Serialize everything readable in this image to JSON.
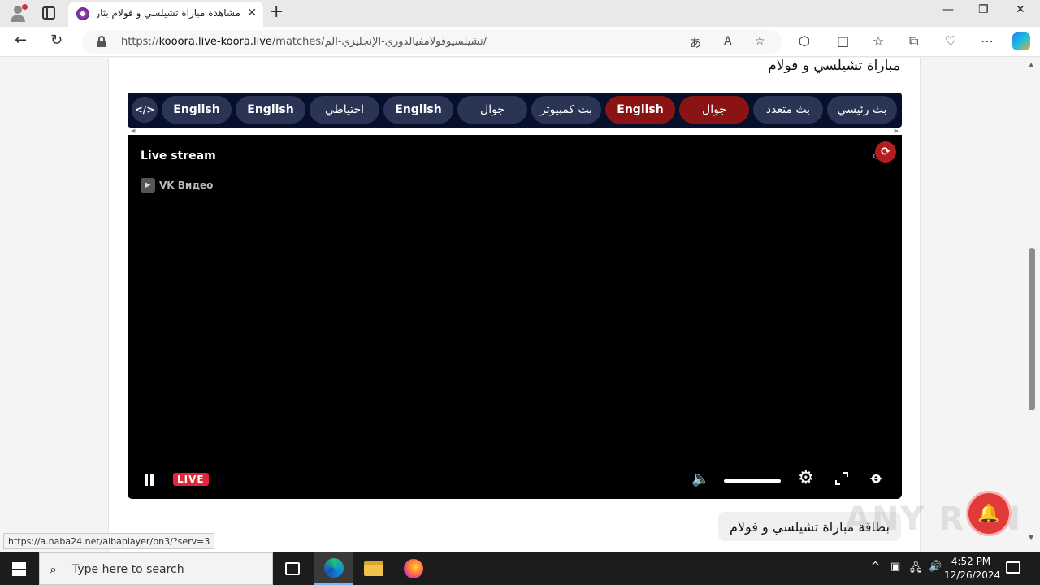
{
  "browser": {
    "tab_title": "مشاهدة مباراة تشيلسي و فولام بثار",
    "url_scheme": "https://",
    "url_host": "kooora.live-koora.live",
    "url_path": "/matches/تشيلسيوفولامفيالدوري-الإنجليزي-الم/",
    "status_url": "https://a.naba24.net/albaplayer/bn3/?serv=3"
  },
  "page": {
    "heading": "مباراة تشيلسي و فولام",
    "card_title": "بطاقة مباراة تشيلسي و فولام",
    "embed_icon": "</>",
    "servers": [
      {
        "label": "بث رئيسي",
        "active": false
      },
      {
        "label": "بث متعدد",
        "active": false
      },
      {
        "label": "جوال",
        "active": true
      },
      {
        "label": "English",
        "active": true
      },
      {
        "label": "بث كمبيوتر",
        "active": false
      },
      {
        "label": "جوال",
        "active": false
      },
      {
        "label": "English",
        "active": false
      },
      {
        "label": "احتياطي",
        "active": false
      },
      {
        "label": "English",
        "active": false
      },
      {
        "label": "English",
        "active": false
      }
    ]
  },
  "player": {
    "title": "Live stream",
    "source": "VK Видео",
    "live_badge": "LIVE",
    "volume_level": 1.0
  },
  "watermark": "ANY RUN",
  "taskbar": {
    "search_placeholder": "Type here to search",
    "time": "4:52 PM",
    "date": "12/26/2024"
  },
  "colors": {
    "server_bar": "#07102a",
    "server_button": "#2a3556",
    "server_active": "#8a1313",
    "live_badge": "#e3243b"
  }
}
